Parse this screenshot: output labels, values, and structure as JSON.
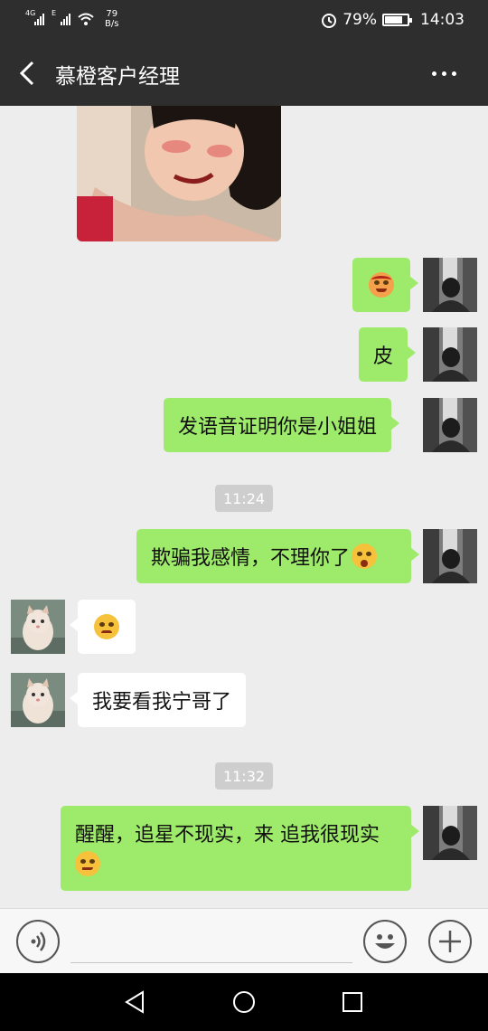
{
  "status_bar": {
    "signal1_label": "4G",
    "signal2_label": "E",
    "net_speed_value": "79",
    "net_speed_unit": "B/s",
    "battery": "79%",
    "battery_level": 0.79,
    "time": "14:03"
  },
  "header": {
    "title": "慕橙客户经理",
    "back_icon": "chevron-left-icon",
    "more_icon": "more-dots-icon"
  },
  "messages": [
    {
      "sender": "me",
      "text": "",
      "emoji": "angry-face"
    },
    {
      "sender": "me",
      "text": "皮"
    },
    {
      "sender": "me",
      "text": "发语音证明你是小姐姐"
    },
    {
      "sender": "me",
      "text": "欺骗我感情，不理你了",
      "emoji": "surprised-face"
    },
    {
      "sender": "them",
      "text": "",
      "emoji": "sweat-face"
    },
    {
      "sender": "them",
      "text": "我要看我宁哥了"
    },
    {
      "sender": "me",
      "text": "醒醒，追星不现实，来 追我很现实",
      "emoji": "smirk-face"
    }
  ],
  "timestamps": [
    "11:24",
    "11:32"
  ],
  "input_bar": {
    "voice_icon": "voice-icon",
    "text_value": "",
    "emoji_icon": "smiley-icon",
    "plus_icon": "plus-icon"
  },
  "nav_bar": {
    "back_icon": "triangle-back-icon",
    "home_icon": "circle-home-icon",
    "recents_icon": "square-recents-icon"
  },
  "colors": {
    "header_bg": "#2e2e2e",
    "chat_bg": "#ededed",
    "my_bubble": "#9eea6a",
    "their_bubble": "#ffffff"
  }
}
